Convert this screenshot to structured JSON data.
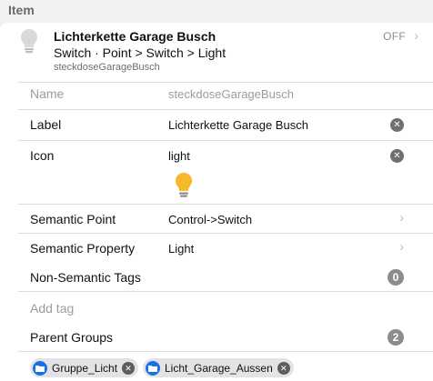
{
  "section": {
    "title": "Item"
  },
  "header": {
    "title": "Lichterkette Garage Busch",
    "subtitle": "Switch · Point > Switch > Light",
    "name": "steckdoseGarageBusch",
    "state": "OFF",
    "icon": "lightbulb-off-icon"
  },
  "fields": {
    "name": {
      "label": "Name",
      "value": "steckdoseGarageBusch"
    },
    "label": {
      "label": "Label",
      "value": "Lichterkette Garage Busch"
    },
    "icon": {
      "label": "Icon",
      "value": "light",
      "preview_icon": "lightbulb-on-icon"
    },
    "semantic_point": {
      "label": "Semantic Point",
      "value": "Control->Switch"
    },
    "semantic_property": {
      "label": "Semantic Property",
      "value": "Light"
    },
    "non_semantic_tags": {
      "label": "Non-Semantic Tags",
      "count": "0"
    },
    "add_tag": {
      "placeholder": "Add tag"
    },
    "parent_groups": {
      "label": "Parent Groups",
      "count": "2",
      "groups": [
        "Gruppe_Licht",
        "Licht_Garage_Aussen"
      ]
    }
  },
  "colors": {
    "accent": "#1b6fe8",
    "bulb_on": "#f7b928",
    "badge": "#8c8c8e"
  }
}
